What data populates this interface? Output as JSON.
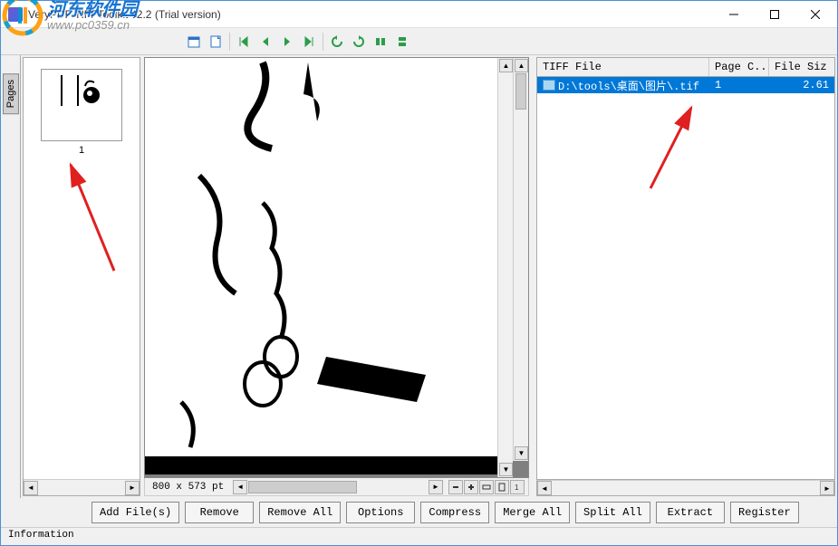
{
  "window": {
    "title": "VeryPDF TIFFToolkit v2.2 (Trial version)"
  },
  "watermark": {
    "name_cn": "河东软件园",
    "url": "www.pc0359.cn"
  },
  "pages": {
    "tab_label": "Pages",
    "thumbs": [
      {
        "number": "1"
      }
    ]
  },
  "preview": {
    "dimensions": "800 x 573 pt"
  },
  "file_table": {
    "headers": {
      "file": "TIFF File",
      "pages": "Page C...",
      "size": "File Siz"
    },
    "rows": [
      {
        "path": "D:\\tools\\桌面\\图片\\.tif",
        "pages": "1",
        "size": "2.61"
      }
    ]
  },
  "buttons": {
    "add": "Add File(s)",
    "remove": "Remove",
    "remove_all": "Remove All",
    "options": "Options",
    "compress": "Compress",
    "merge": "Merge All",
    "split": "Split All",
    "extract": "Extract",
    "register": "Register"
  },
  "info": {
    "label": "Information"
  },
  "icons": {
    "open": "open-icon",
    "save": "save-icon",
    "page_prev": "page-prev-icon",
    "page_next": "page-next-icon",
    "zoom_in": "zoom-in-icon",
    "zoom_out": "zoom-out-icon",
    "fit": "fit-icon",
    "rotate_l": "rotate-left-icon",
    "rotate_r": "rotate-right-icon",
    "flip_h": "flip-h-icon",
    "flip_v": "flip-v-icon"
  }
}
